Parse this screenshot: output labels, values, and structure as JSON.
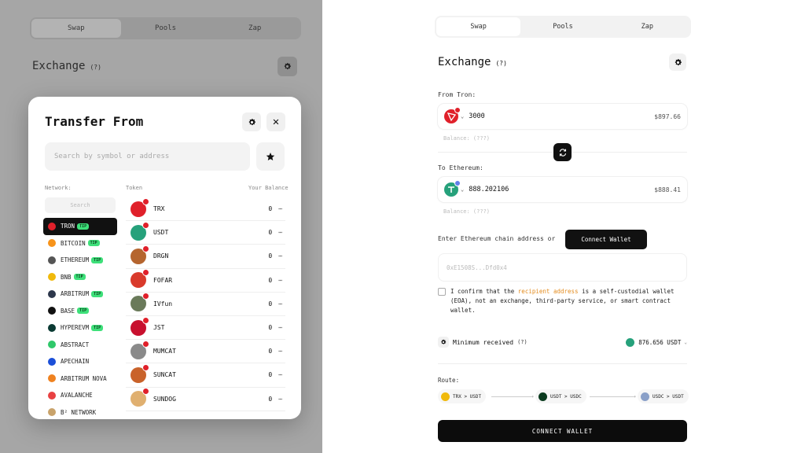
{
  "background_panel": {
    "tabs": [
      "Swap",
      "Pools",
      "Zap"
    ],
    "title": "Exchange",
    "help": "(?)"
  },
  "modal": {
    "title": "Transfer From",
    "search_placeholder": "Search by symbol or address",
    "network_header": "Network:",
    "token_header": "Token",
    "balance_header": "Your Balance",
    "network_search_placeholder": "Search",
    "networks": [
      {
        "name": "TRON",
        "tip": "TIP",
        "color": "#e0202a"
      },
      {
        "name": "BITCOIN",
        "tip": "TIP",
        "color": "#f7931a"
      },
      {
        "name": "ETHEREUM",
        "tip": "TIP",
        "color": "#555555"
      },
      {
        "name": "BNB",
        "tip": "TIP",
        "color": "#f0b90b"
      },
      {
        "name": "ARBITRUM",
        "tip": "TIP",
        "color": "#2d374b"
      },
      {
        "name": "BASE",
        "tip": "TIP",
        "color": "#111111"
      },
      {
        "name": "HYPEREVM",
        "tip": "TIP",
        "color": "#0a3a33"
      },
      {
        "name": "ABSTRACT",
        "tip": "",
        "color": "#2fc86a"
      },
      {
        "name": "APECHAIN",
        "tip": "",
        "color": "#1b4fd8"
      },
      {
        "name": "ARBITRUM NOVA",
        "tip": "",
        "color": "#ef8220"
      },
      {
        "name": "AVALANCHE",
        "tip": "",
        "color": "#e84142"
      },
      {
        "name": "B² NETWORK",
        "tip": "",
        "color": "#c9a36b"
      }
    ],
    "tokens": [
      {
        "symbol": "TRX",
        "balance": "0",
        "color": "#e0202a"
      },
      {
        "symbol": "USDT",
        "balance": "0",
        "color": "#26a17b"
      },
      {
        "symbol": "DRGN",
        "balance": "0",
        "color": "#b5652e"
      },
      {
        "symbol": "FOFAR",
        "balance": "0",
        "color": "#d93a2b"
      },
      {
        "symbol": "IVfun",
        "balance": "0",
        "color": "#6a7a5a"
      },
      {
        "symbol": "JST",
        "balance": "0",
        "color": "#c8102e"
      },
      {
        "symbol": "MUMCAT",
        "balance": "0",
        "color": "#8a8a8a"
      },
      {
        "symbol": "SUNCAT",
        "balance": "0",
        "color": "#c9622a"
      },
      {
        "symbol": "SUNDOG",
        "balance": "0",
        "color": "#e0b070"
      }
    ],
    "more_glyph": "⋯"
  },
  "panel": {
    "tabs": [
      "Swap",
      "Pools",
      "Zap"
    ],
    "title": "Exchange",
    "help": "(?)",
    "from_label": "From Tron:",
    "from_amount": "3000",
    "from_usd": "$897.66",
    "from_balance": "Balance: (???)",
    "to_label": "To Ethereum:",
    "to_amount": "888.202106",
    "to_usd": "$888.41",
    "to_balance": "Balance: (???)",
    "address_prompt": "Enter Ethereum chain address or",
    "connect_wallet_small": "Connect Wallet",
    "address_placeholder": "0xE1508S...Dfd0x4",
    "confirm_pre": "I confirm that the",
    "confirm_link": "recipient address",
    "confirm_post": "is a self-custodial wallet (EOA), not an exchange, third-party service, or smart contract wallet.",
    "min_received_label": "Minimum received",
    "min_received_help": "(?)",
    "min_received_value": "876.656 USDT",
    "route_label": "Route:",
    "route": [
      "TRX > USDT",
      "USDT > USDC",
      "USDC > USDT"
    ],
    "connect_wallet_main": "CONNECT WALLET"
  },
  "colors": {
    "tron": "#e0202a",
    "usdt": "#26a17b",
    "accent_link": "#e38b1d",
    "tip_badge": "#3ee07a"
  }
}
